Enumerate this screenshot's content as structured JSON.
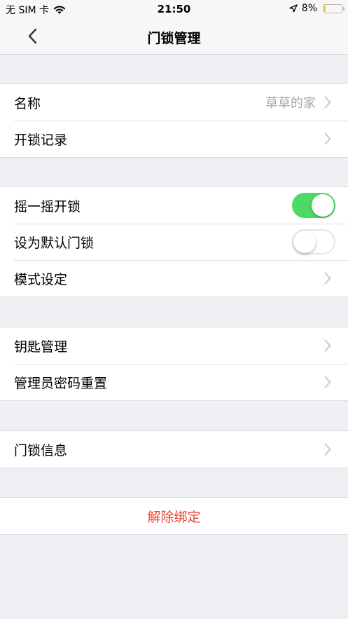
{
  "status_bar": {
    "carrier": "无 SIM 卡",
    "time": "21:50",
    "battery_text": "8%",
    "battery_level": 0.08,
    "battery_color": "#f5c518"
  },
  "nav": {
    "title": "门锁管理",
    "back_icon": "chevron-left-icon"
  },
  "group1": {
    "name_label": "名称",
    "name_value": "草草的家",
    "unlock_records_label": "开锁记录"
  },
  "group2": {
    "shake_unlock_label": "摇一摇开锁",
    "shake_unlock_on": true,
    "default_lock_label": "设为默认门锁",
    "default_lock_on": false,
    "mode_settings_label": "模式设定",
    "toggle_on_color": "#4cd964"
  },
  "group3": {
    "key_management_label": "钥匙管理",
    "admin_password_reset_label": "管理员密码重置"
  },
  "group4": {
    "lock_info_label": "门锁信息"
  },
  "group5": {
    "unbind_label": "解除绑定",
    "unbind_color": "#e8452e"
  }
}
